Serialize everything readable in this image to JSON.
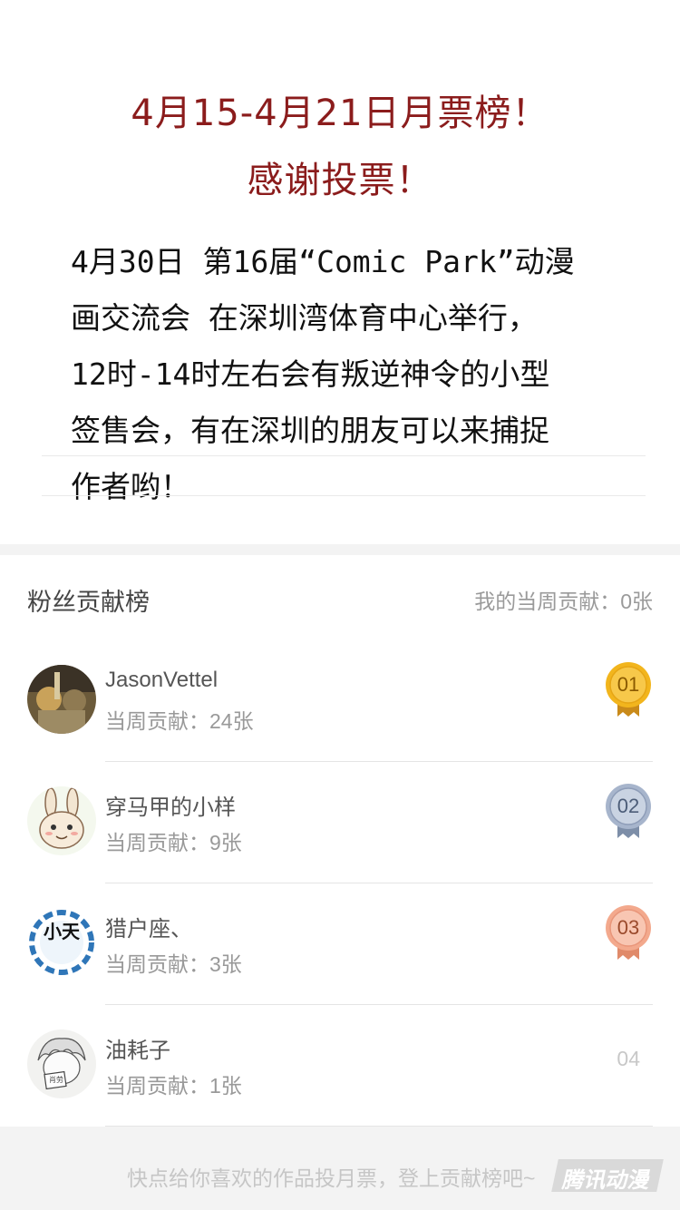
{
  "announcement": {
    "title_line1": "4月15-4月21日月票榜！",
    "title_line2": "感谢投票！",
    "body_lines": [
      "4月30日 第16届“Comic Park”动漫",
      "画交流会 在深圳湾体育中心举行，",
      "12时-14时左右会有叛逆神令的小型",
      "签售会，有在深圳的朋友可以来捕捉",
      "作者哟！"
    ]
  },
  "leaderboard": {
    "title": "粉丝贡献榜",
    "my_contribution": "我的当周贡献：0张",
    "entries": [
      {
        "name": "JasonVettel",
        "contribution": "当周贡献：24张",
        "rank": "01",
        "medal": "gold"
      },
      {
        "name": "穿马甲的小样",
        "contribution": "当周贡献：9张",
        "rank": "02",
        "medal": "silver"
      },
      {
        "name": "猎户座、",
        "contribution": "当周贡献：3张",
        "rank": "03",
        "medal": "bronze"
      },
      {
        "name": "油耗子",
        "contribution": "当周贡献：1张",
        "rank": "04",
        "medal": "none"
      }
    ],
    "avatar3_glyphs": "小天",
    "avatar4_glyphs": "肖劳"
  },
  "footer": {
    "prompt": "快点给你喜欢的作品投月票，登上贡献榜吧~",
    "watermark": "腾讯动漫"
  },
  "colors": {
    "title_red": "#8b1c1c",
    "gold": "#f2b51d",
    "silver": "#a7b5cc",
    "bronze": "#f3a98d"
  }
}
